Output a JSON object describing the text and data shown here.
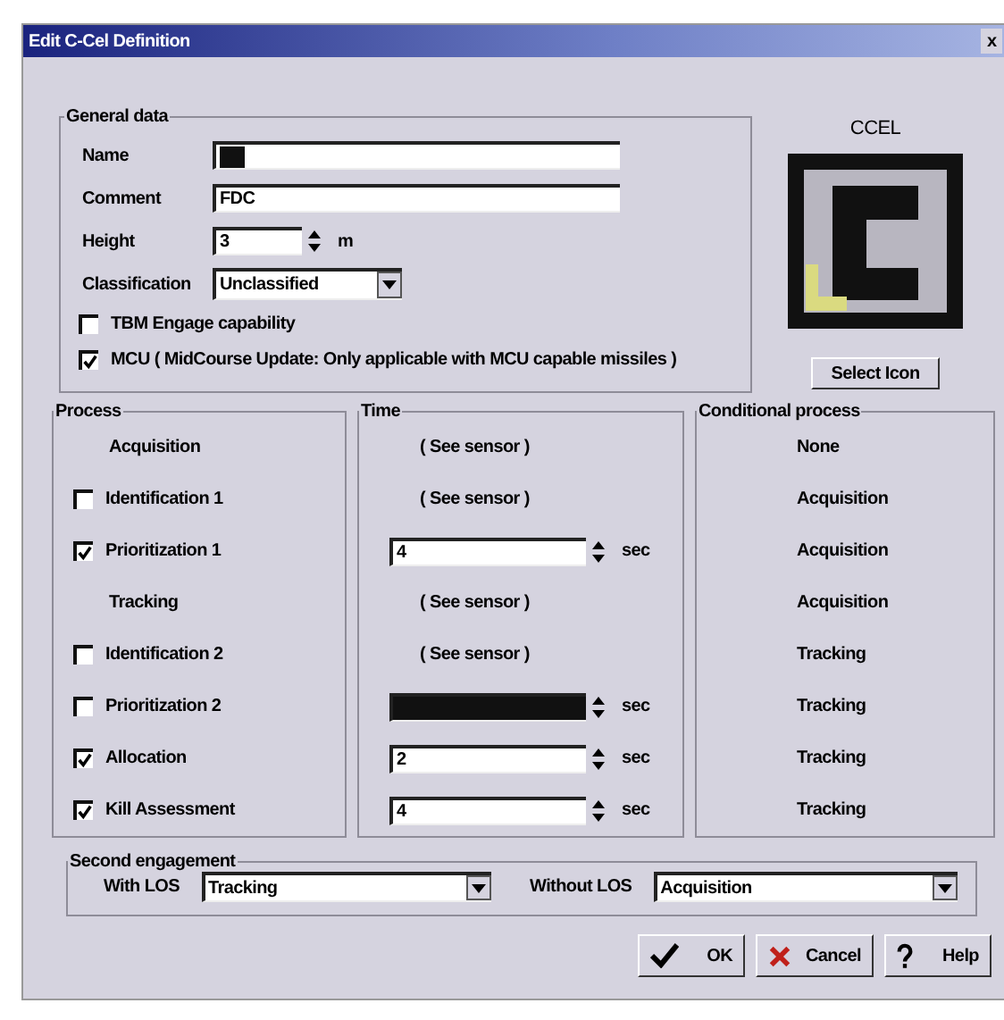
{
  "window": {
    "title": "Edit C-Cel Definition",
    "close": "x"
  },
  "general": {
    "legend": "General data",
    "name": {
      "label": "Name",
      "redacted": true
    },
    "comment": {
      "label": "Comment",
      "value": "FDC"
    },
    "height": {
      "label": "Height",
      "value": "3",
      "unit": "m"
    },
    "classification": {
      "label": "Classification",
      "value": "Unclassified"
    },
    "options": [
      {
        "label": "TBM Engage capability",
        "checked": false
      },
      {
        "label": "MCU ( MidCourse Update: Only applicable with MCU capable missiles )",
        "checked": true
      }
    ]
  },
  "icon_panel": {
    "title": "CCEL",
    "button": "Select Icon"
  },
  "process": {
    "legend": "Process",
    "time_legend": "Time",
    "conditional_legend": "Conditional process",
    "rows": [
      {
        "kind": "label",
        "label": "Acquisition",
        "time": {
          "kind": "text",
          "text": "( See sensor )"
        },
        "conditional": "None"
      },
      {
        "kind": "checkbox",
        "label": "Identification 1",
        "checked": false,
        "time": {
          "kind": "text",
          "text": "( See sensor )"
        },
        "conditional": "Acquisition"
      },
      {
        "kind": "checkbox",
        "label": "Prioritization 1",
        "checked": true,
        "time": {
          "kind": "spin",
          "value": "4",
          "unit": "sec",
          "redacted": false
        },
        "conditional": "Acquisition"
      },
      {
        "kind": "label",
        "label": "Tracking",
        "time": {
          "kind": "text",
          "text": "( See sensor )"
        },
        "conditional": "Acquisition"
      },
      {
        "kind": "checkbox",
        "label": "Identification 2",
        "checked": false,
        "time": {
          "kind": "text",
          "text": "( See sensor )"
        },
        "conditional": "Tracking"
      },
      {
        "kind": "checkbox",
        "label": "Prioritization 2",
        "checked": false,
        "time": {
          "kind": "spin",
          "unit": "sec",
          "redacted": true
        },
        "conditional": "Tracking"
      },
      {
        "kind": "checkbox",
        "label": "Allocation",
        "checked": true,
        "time": {
          "kind": "spin",
          "value": "2",
          "unit": "sec",
          "redacted": false
        },
        "conditional": "Tracking"
      },
      {
        "kind": "checkbox",
        "label": "Kill Assessment",
        "checked": true,
        "time": {
          "kind": "spin",
          "value": "4",
          "unit": "sec",
          "redacted": false
        },
        "conditional": "Tracking"
      }
    ]
  },
  "second_engagement": {
    "legend": "Second engagement",
    "with_los": {
      "label": "With LOS",
      "value": "Tracking"
    },
    "without_los": {
      "label": "Without LOS",
      "value": "Acquisition"
    }
  },
  "buttons": [
    {
      "kind": "ok",
      "label": "OK"
    },
    {
      "kind": "cancel",
      "label": "Cancel"
    },
    {
      "kind": "help",
      "label": "Help"
    }
  ]
}
